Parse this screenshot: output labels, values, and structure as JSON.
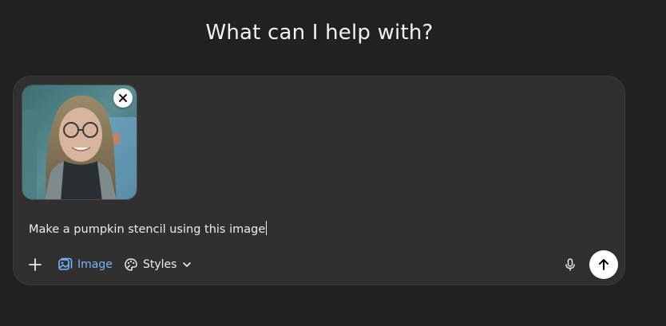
{
  "header": {
    "title": "What can I help with?"
  },
  "composer": {
    "attachment": {
      "kind": "image",
      "remove_icon": "close-icon"
    },
    "prompt_text": "Make a pumpkin stencil using this image",
    "toolbar": {
      "add_icon": "plus-icon",
      "image_label": "Image",
      "image_icon": "image-icon",
      "styles_label": "Styles",
      "styles_icon": "palette-icon",
      "dropdown_icon": "chevron-down-icon",
      "mic_icon": "microphone-icon",
      "send_icon": "arrow-up-icon"
    }
  },
  "colors": {
    "background": "#212121",
    "composer": "#303030",
    "accent": "#7ab4ff",
    "text": "#ececec"
  }
}
